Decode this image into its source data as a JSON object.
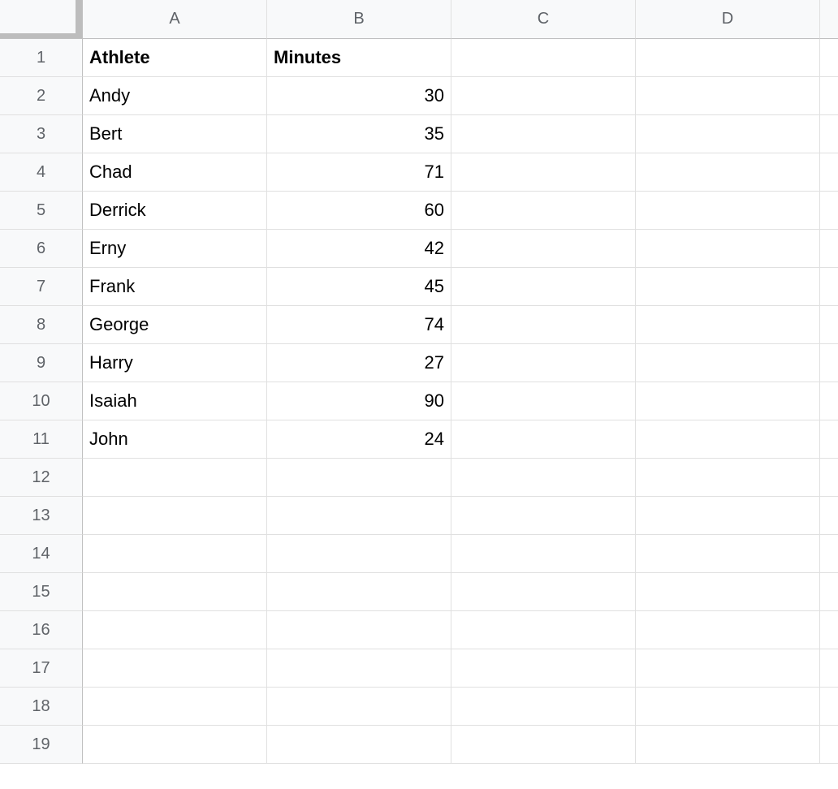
{
  "columns": [
    "A",
    "B",
    "C",
    "D"
  ],
  "rowCount": 19,
  "headers": {
    "A": "Athlete",
    "B": "Minutes"
  },
  "rows": [
    {
      "athlete": "Andy",
      "minutes": "30"
    },
    {
      "athlete": "Bert",
      "minutes": "35"
    },
    {
      "athlete": "Chad",
      "minutes": "71"
    },
    {
      "athlete": "Derrick",
      "minutes": "60"
    },
    {
      "athlete": "Erny",
      "minutes": "42"
    },
    {
      "athlete": "Frank",
      "minutes": "45"
    },
    {
      "athlete": "George",
      "minutes": "74"
    },
    {
      "athlete": "Harry",
      "minutes": "27"
    },
    {
      "athlete": "Isaiah",
      "minutes": "90"
    },
    {
      "athlete": "John",
      "minutes": "24"
    }
  ],
  "chart_data": {
    "type": "table",
    "title": "",
    "columns": [
      "Athlete",
      "Minutes"
    ],
    "data": [
      [
        "Andy",
        30
      ],
      [
        "Bert",
        35
      ],
      [
        "Chad",
        71
      ],
      [
        "Derrick",
        60
      ],
      [
        "Erny",
        42
      ],
      [
        "Frank",
        45
      ],
      [
        "George",
        74
      ],
      [
        "Harry",
        27
      ],
      [
        "Isaiah",
        90
      ],
      [
        "John",
        24
      ]
    ]
  }
}
